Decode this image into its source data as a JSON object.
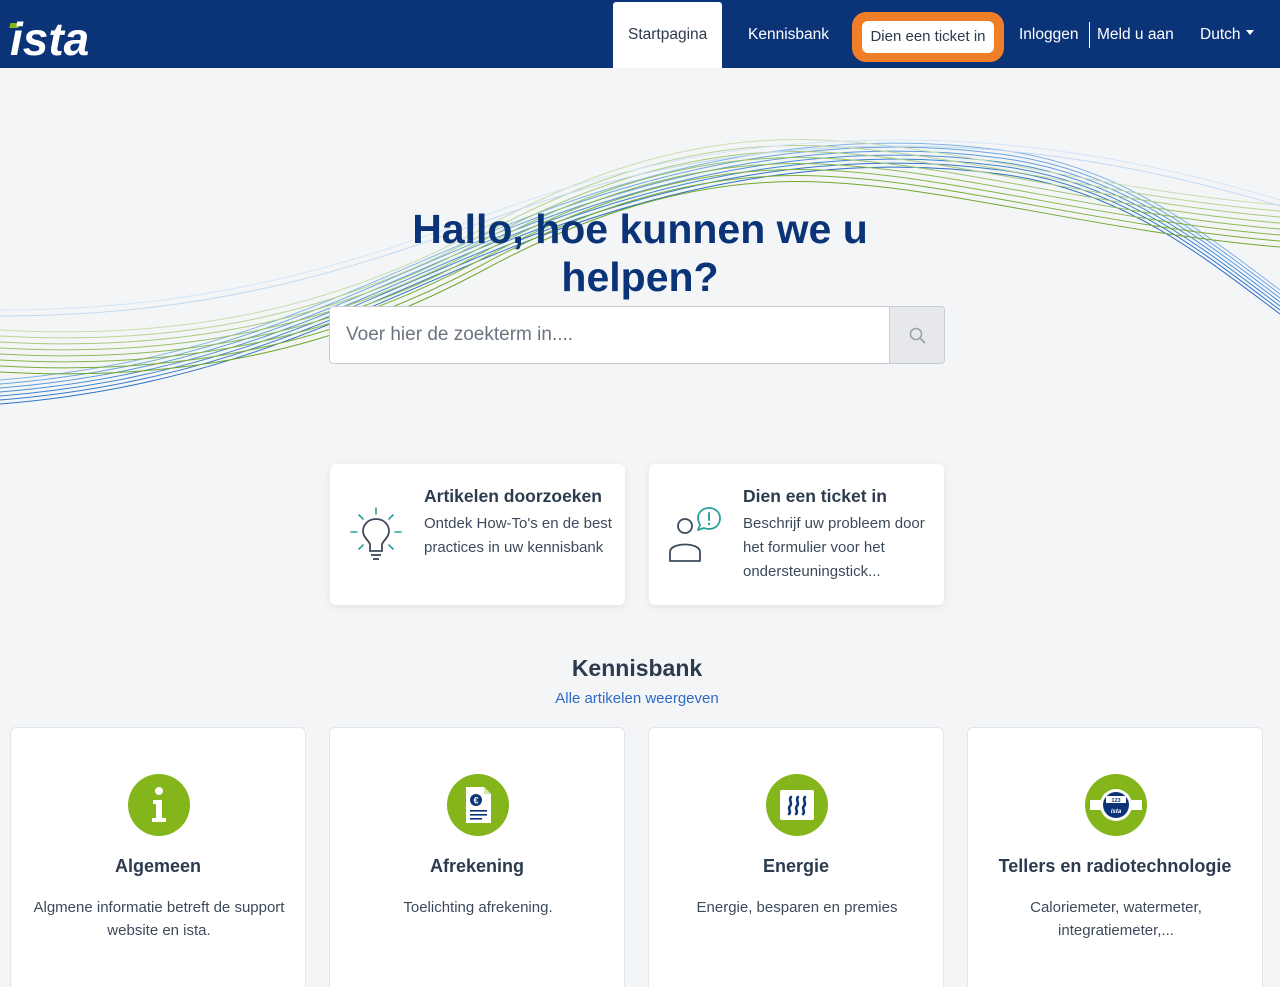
{
  "brand": {
    "logo_text": "ista",
    "primary_color": "#0b3478",
    "accent_color": "#f07d28",
    "green": "#84b51a"
  },
  "nav": {
    "home": "Startpagina",
    "knowledge_base": "Kennisbank",
    "submit_ticket": "Dien een ticket in",
    "login": "Inloggen",
    "register": "Meld u aan",
    "language": "Dutch"
  },
  "hero": {
    "title": "Hallo, hoe kunnen we u helpen?",
    "search_placeholder": "Voer hier de zoekterm in...."
  },
  "actions": [
    {
      "title": "Artikelen doorzoeken",
      "description": "Ontdek How-To's en de best practices in uw kennisbank",
      "icon": "lightbulb-icon"
    },
    {
      "title": "Dien een ticket in",
      "description": "Beschrijf uw probleem door het formulier voor het ondersteuningstick...",
      "icon": "user-alert-icon"
    }
  ],
  "knowledge_base": {
    "title": "Kennisbank",
    "view_all": "Alle artikelen weergeven",
    "categories": [
      {
        "name": "Algemeen",
        "description": "Algmene informatie betreft de support website en ista.",
        "icon": "info-icon"
      },
      {
        "name": "Afrekening",
        "description": "Toelichting afrekening.",
        "icon": "invoice-euro-icon"
      },
      {
        "name": "Energie",
        "description": "Energie, besparen en premies",
        "icon": "heat-icon"
      },
      {
        "name": "Tellers en radiotechnologie",
        "description": "Caloriemeter, watermeter, integratiemeter,...",
        "icon": "meter-icon"
      }
    ],
    "meter_icon_text": {
      "reading": "123",
      "brand": "ista"
    }
  }
}
